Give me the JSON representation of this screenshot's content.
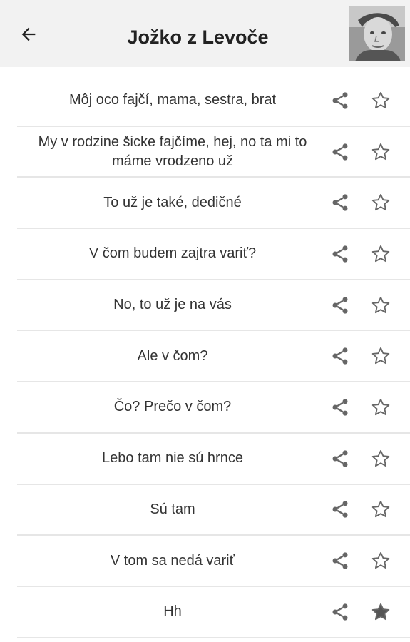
{
  "header": {
    "title": "Jožko z Levoče",
    "back_icon": "arrow-left-icon",
    "avatar_alt": "avatar"
  },
  "colors": {
    "appbar_bg": "#f2f2f2",
    "icon": "#666666",
    "divider": "#e6e6e6",
    "text": "#333333"
  },
  "list": {
    "items": [
      {
        "text": "Môj oco fajčí, mama, sestra, brat",
        "favorite": false
      },
      {
        "text": "My v rodzine šicke fajčíme, hej, no ta mi to máme vrodzeno už",
        "favorite": false
      },
      {
        "text": "To už je také, dedičné",
        "favorite": false
      },
      {
        "text": "V čom budem zajtra variť?",
        "favorite": false
      },
      {
        "text": "No, to už je na vás",
        "favorite": false
      },
      {
        "text": "Ale v čom?",
        "favorite": false
      },
      {
        "text": "Čo? Prečo v čom?",
        "favorite": false
      },
      {
        "text": "Lebo tam nie sú hrnce",
        "favorite": false
      },
      {
        "text": "Sú tam",
        "favorite": false
      },
      {
        "text": "V tom sa nedá variť",
        "favorite": false
      },
      {
        "text": "Hh",
        "favorite": true
      }
    ]
  }
}
